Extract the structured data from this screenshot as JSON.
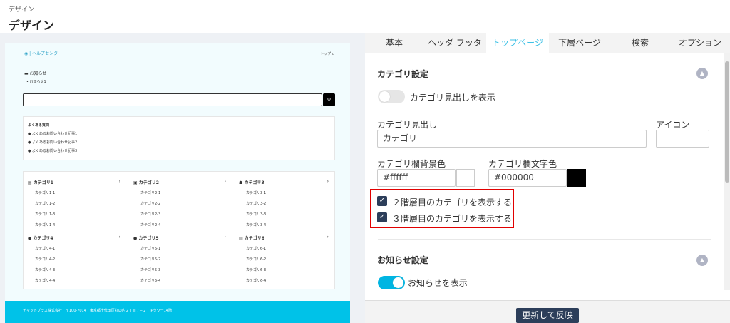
{
  "header": {
    "breadcrumb": "デザイン",
    "title": "デザイン"
  },
  "preview": {
    "logo": "ヘルプセンター",
    "top_link": "トップ",
    "news": {
      "title": "お知らせ",
      "item": "お知らせ1"
    },
    "faq": {
      "title": "よくある質問",
      "items": [
        "よくあるお問い合わせ記事1",
        "よくあるお問い合わせ記事2",
        "よくあるお問い合わせ記事3"
      ]
    },
    "categories": [
      {
        "name": "カテゴリ1",
        "items": [
          "カテゴリ1-1",
          "カテゴリ1-2",
          "カテゴリ1-3",
          "カテゴリ1-4"
        ]
      },
      {
        "name": "カテゴリ2",
        "items": [
          "カテゴリ2-1",
          "カテゴリ2-2",
          "カテゴリ2-3",
          "カテゴリ2-4"
        ]
      },
      {
        "name": "カテゴリ3",
        "items": [
          "カテゴリ3-1",
          "カテゴリ3-2",
          "カテゴリ3-3",
          "カテゴリ3-4"
        ]
      },
      {
        "name": "カテゴリ4",
        "items": [
          "カテゴリ4-1",
          "カテゴリ4-2",
          "カテゴリ4-3",
          "カテゴリ4-4"
        ]
      },
      {
        "name": "カテゴリ5",
        "items": [
          "カテゴリ5-1",
          "カテゴリ5-2",
          "カテゴリ5-3",
          "カテゴリ5-4"
        ]
      },
      {
        "name": "カテゴリ6",
        "items": [
          "カテゴリ6-1",
          "カテゴリ6-2",
          "カテゴリ6-3",
          "カテゴリ6-4"
        ]
      }
    ],
    "footer": "チャットプラス株式会社　〒100-7014　東京都千代田区丸の内２丁目７−２　JPタワー14階"
  },
  "tabs": [
    "基本",
    "ヘッダ フッタ",
    "トップページ",
    "下層ページ",
    "検索",
    "オプション"
  ],
  "active_tab": "トップページ",
  "category_settings": {
    "title": "カテゴリ設定",
    "show_heading_label": "カテゴリ見出しを表示",
    "show_heading_on": false,
    "heading_label": "カテゴリ見出し",
    "heading_value": "カテゴリ",
    "icon_label": "アイコン",
    "bg_color_label": "カテゴリ欄背景色",
    "bg_color_value": "#ffffff",
    "text_color_label": "カテゴリ欄文字色",
    "text_color_value": "#000000",
    "checkbox_2nd": "２階層目のカテゴリを表示する",
    "checkbox_3rd": "３階層目のカテゴリを表示する"
  },
  "news_settings": {
    "title": "お知らせ設定",
    "show_label": "お知らせを表示",
    "show_on": true
  },
  "update_button": "更新して反映",
  "colors": {
    "accent": "#3ec1e6",
    "navy": "#2c3e5a",
    "footer": "#00c2e8",
    "highlight": "#e10000"
  }
}
